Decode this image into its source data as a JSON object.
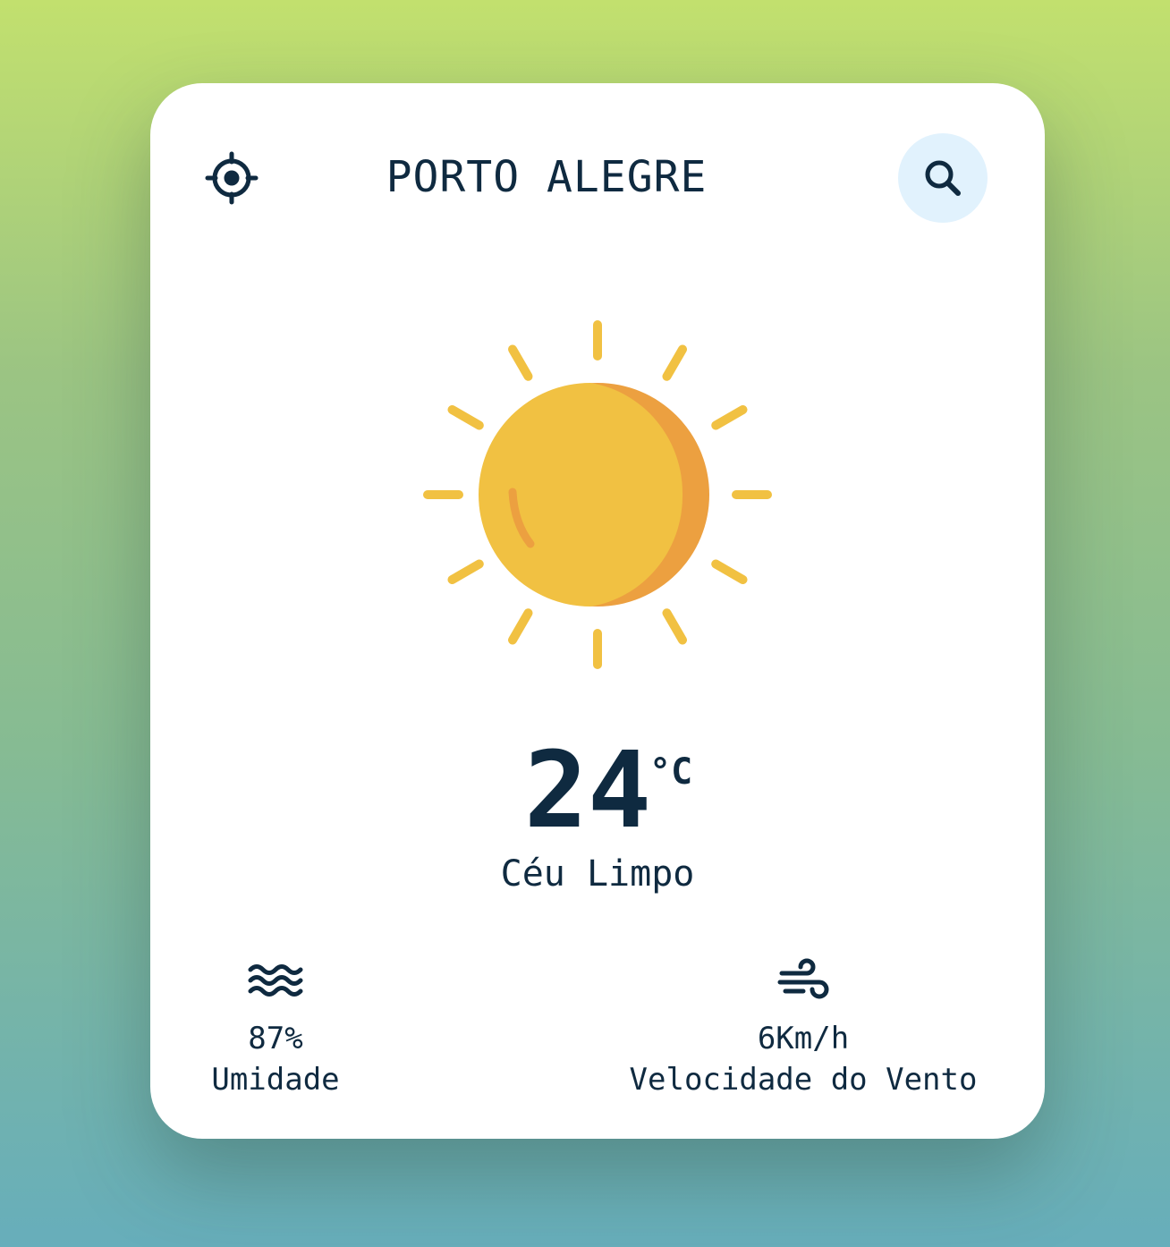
{
  "location": {
    "city": "PORTO ALEGRE",
    "locate_icon": "crosshair-icon",
    "search_icon": "search-icon"
  },
  "current": {
    "temperature": "24",
    "unit": "°C",
    "condition": "Céu Limpo",
    "icon": "sun-icon"
  },
  "details": {
    "humidity": {
      "value": "87%",
      "label": "Umidade",
      "icon": "humidity-waves-icon"
    },
    "wind": {
      "value": "6Km/h",
      "label": "Velocidade do Vento",
      "icon": "wind-icon"
    }
  },
  "colors": {
    "text": "#0f2a40",
    "search_bg": "#e1f2fd",
    "sun_yellow": "#f1c142",
    "sun_orange": "#eca040"
  }
}
